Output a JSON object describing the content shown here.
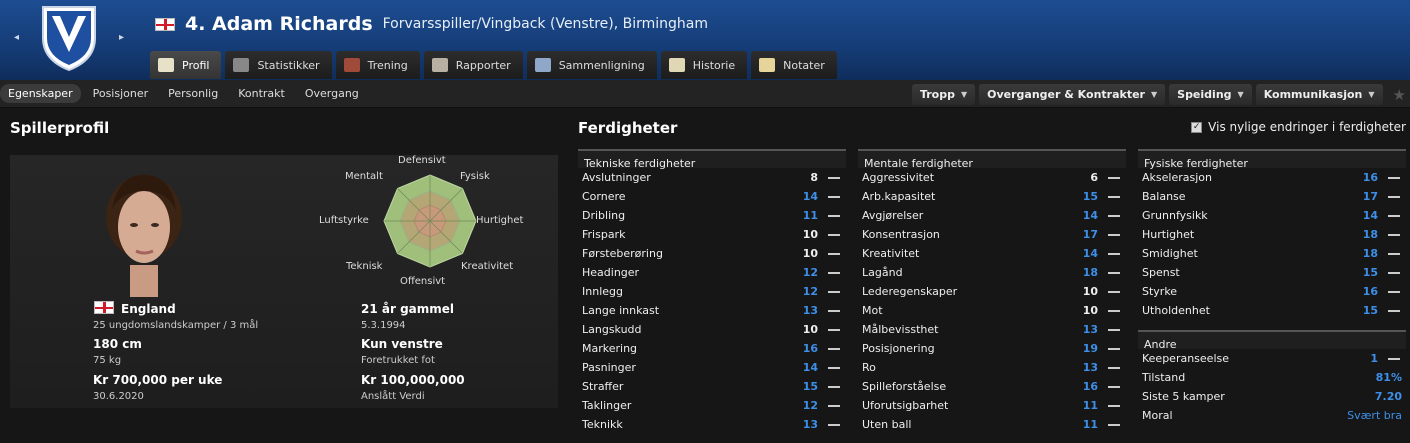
{
  "header": {
    "title": "4. Adam Richards",
    "subtitle": "Forvarsspiller/Vingback (Venstre), Birmingham",
    "nav_prev": "◂",
    "nav_next": "▸",
    "tabs": [
      {
        "label": "Profil",
        "icon": "profile-icon",
        "active": true
      },
      {
        "label": "Statistikker",
        "icon": "bar-chart-icon"
      },
      {
        "label": "Trening",
        "icon": "ball-icon"
      },
      {
        "label": "Rapporter",
        "icon": "report-icon"
      },
      {
        "label": "Sammenligning",
        "icon": "compare-icon"
      },
      {
        "label": "Historie",
        "icon": "history-icon"
      },
      {
        "label": "Notater",
        "icon": "notes-icon"
      }
    ]
  },
  "subnav": {
    "tabs": [
      "Egenskaper",
      "Posisjoner",
      "Personlig",
      "Kontrakt",
      "Overgang"
    ],
    "menus": [
      "Tropp",
      "Overganger & Kontrakter",
      "Speiding",
      "Kommunikasjon"
    ]
  },
  "profile": {
    "section_title": "Spillerprofil",
    "nation": "England",
    "caps": "25 ungdomslandskamper / 3 mål",
    "age": "21 år gammel",
    "dob": "5.3.1994",
    "height": "180 cm",
    "weight": "75 kg",
    "foot": "Kun venstre",
    "foot_label": "Foretrukket fot",
    "wage": "Kr 700,000 per uke",
    "contract_end": "30.6.2020",
    "value": "Kr 100,000,000",
    "value_label": "Anslått Verdi",
    "radar_labels": {
      "defensivt": "Defensivt",
      "fysisk": "Fysisk",
      "hurtighet": "Hurtighet",
      "kreativitet": "Kreativitet",
      "offensivt": "Offensivt",
      "teknisk": "Teknisk",
      "luftstyrke": "Luftstyrke",
      "mentalt": "Mentalt"
    }
  },
  "skills": {
    "section_title": "Ferdigheter",
    "recent_changes_label": "Vis nylige endringer i ferdigheter",
    "technical": {
      "title": "Tekniske ferdigheter",
      "rows": [
        {
          "name": "Avslutninger",
          "value": "8",
          "color": "white"
        },
        {
          "name": "Cornere",
          "value": "14",
          "color": "blue"
        },
        {
          "name": "Dribling",
          "value": "11",
          "color": "blue"
        },
        {
          "name": "Frispark",
          "value": "10",
          "color": "white"
        },
        {
          "name": "Førsteberøring",
          "value": "10",
          "color": "white"
        },
        {
          "name": "Headinger",
          "value": "12",
          "color": "blue"
        },
        {
          "name": "Innlegg",
          "value": "12",
          "color": "blue"
        },
        {
          "name": "Lange innkast",
          "value": "13",
          "color": "blue"
        },
        {
          "name": "Langskudd",
          "value": "10",
          "color": "white"
        },
        {
          "name": "Markering",
          "value": "16",
          "color": "blue"
        },
        {
          "name": "Pasninger",
          "value": "14",
          "color": "blue"
        },
        {
          "name": "Straffer",
          "value": "15",
          "color": "blue"
        },
        {
          "name": "Taklinger",
          "value": "12",
          "color": "blue"
        },
        {
          "name": "Teknikk",
          "value": "13",
          "color": "blue"
        }
      ]
    },
    "mental": {
      "title": "Mentale ferdigheter",
      "rows": [
        {
          "name": "Aggressivitet",
          "value": "6",
          "color": "white"
        },
        {
          "name": "Arb.kapasitet",
          "value": "15",
          "color": "blue"
        },
        {
          "name": "Avgjørelser",
          "value": "14",
          "color": "blue"
        },
        {
          "name": "Konsentrasjon",
          "value": "17",
          "color": "blue"
        },
        {
          "name": "Kreativitet",
          "value": "14",
          "color": "blue"
        },
        {
          "name": "Lagånd",
          "value": "18",
          "color": "blue"
        },
        {
          "name": "Lederegenskaper",
          "value": "10",
          "color": "white"
        },
        {
          "name": "Mot",
          "value": "10",
          "color": "white"
        },
        {
          "name": "Målbevissthet",
          "value": "13",
          "color": "blue"
        },
        {
          "name": "Posisjonering",
          "value": "19",
          "color": "blue"
        },
        {
          "name": "Ro",
          "value": "13",
          "color": "blue"
        },
        {
          "name": "Spilleforståelse",
          "value": "16",
          "color": "blue"
        },
        {
          "name": "Uforutsigbarhet",
          "value": "11",
          "color": "blue"
        },
        {
          "name": "Uten ball",
          "value": "11",
          "color": "blue"
        }
      ]
    },
    "physical": {
      "title": "Fysiske ferdigheter",
      "rows": [
        {
          "name": "Akselerasjon",
          "value": "16",
          "color": "blue"
        },
        {
          "name": "Balanse",
          "value": "17",
          "color": "blue"
        },
        {
          "name": "Grunnfysikk",
          "value": "14",
          "color": "blue"
        },
        {
          "name": "Hurtighet",
          "value": "18",
          "color": "blue"
        },
        {
          "name": "Smidighet",
          "value": "18",
          "color": "blue"
        },
        {
          "name": "Spenst",
          "value": "15",
          "color": "blue"
        },
        {
          "name": "Styrke",
          "value": "16",
          "color": "blue"
        },
        {
          "name": "Utholdenhet",
          "value": "15",
          "color": "blue"
        }
      ]
    },
    "other": {
      "title": "Andre",
      "rows": [
        {
          "name": "Keeperanseelse",
          "value": "1",
          "color": "blue"
        },
        {
          "name": "Tilstand",
          "value": "81%",
          "color": "blue"
        },
        {
          "name": "Siste 5 kamper",
          "value": "7.20",
          "color": "blue"
        },
        {
          "name": "Moral",
          "value": "Svært bra",
          "color": "blue"
        }
      ]
    }
  }
}
